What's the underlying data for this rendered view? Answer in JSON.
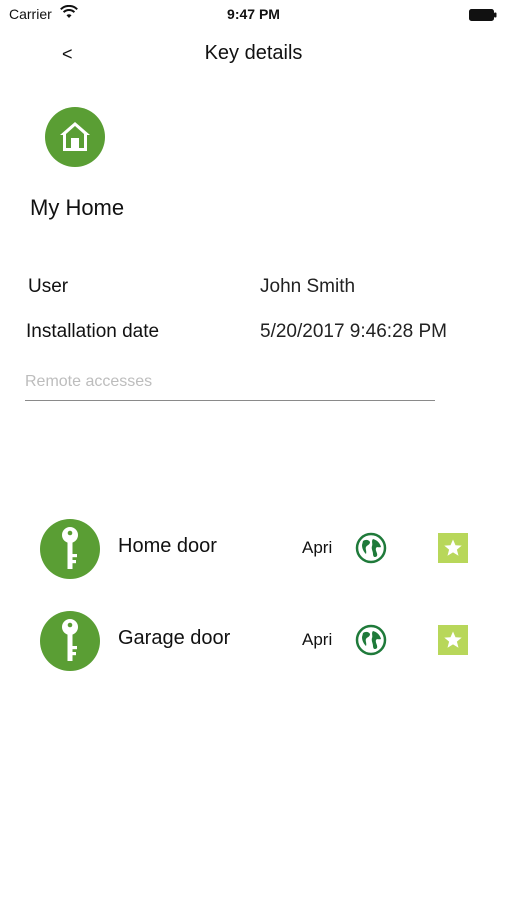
{
  "status_bar": {
    "carrier": "Carrier",
    "time": "9:47 PM",
    "wifi_icon": "wifi-icon",
    "battery_icon": "battery-icon"
  },
  "nav": {
    "back_label": "<",
    "title": "Key details"
  },
  "home": {
    "icon": "home-icon",
    "name": "My Home"
  },
  "details": {
    "user_label": "User",
    "user_value": "John Smith",
    "installation_label": "Installation date",
    "installation_value": "5/20/2017 9:46:28 PM",
    "remote_placeholder": "Remote accesses",
    "remote_value": ""
  },
  "keys": [
    {
      "name": "Home door",
      "date": "Apri",
      "icon": "key-icon",
      "globe_icon": "globe-icon",
      "star_icon": "star-icon"
    },
    {
      "name": "Garage door",
      "date": "Apri",
      "icon": "key-icon",
      "globe_icon": "globe-icon",
      "star_icon": "star-icon"
    }
  ],
  "colors": {
    "brand_green": "#5a9e34",
    "star_green": "#b8d75a",
    "globe_green": "#1f7a3a"
  }
}
